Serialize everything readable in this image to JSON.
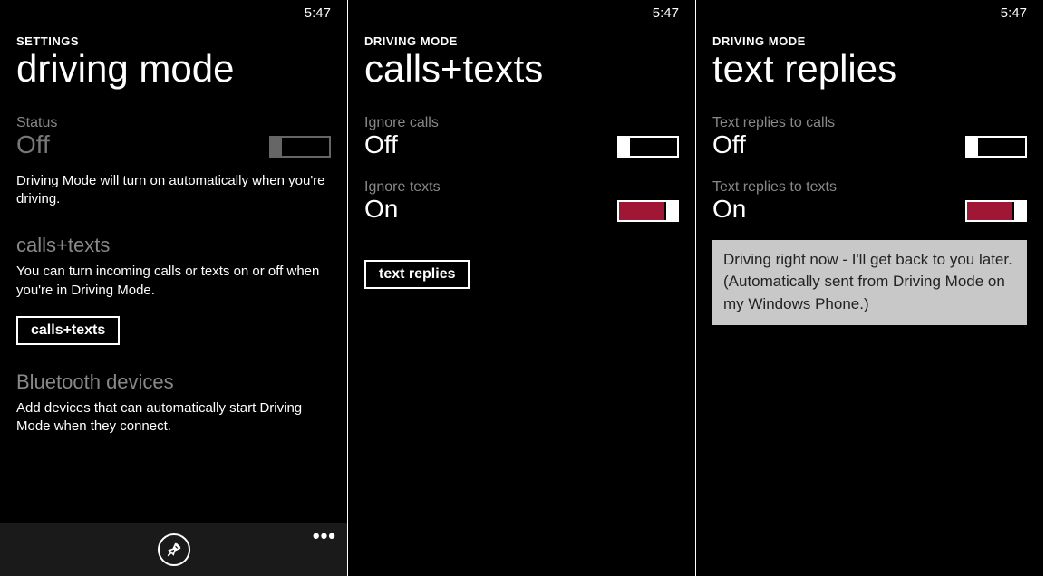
{
  "time": "5:47",
  "screen1": {
    "breadcrumb": "SETTINGS",
    "title": "driving mode",
    "status": {
      "label": "Status",
      "value": "Off",
      "description": "Driving Mode will turn on automatically when you're driving."
    },
    "callsTexts": {
      "title": "calls+texts",
      "description": "You can turn incoming calls or texts on or off when you're in Driving Mode.",
      "button": "calls+texts"
    },
    "bluetooth": {
      "title": "Bluetooth devices",
      "description": "Add devices that can automatically start Driving Mode when they connect."
    }
  },
  "screen2": {
    "breadcrumb": "DRIVING MODE",
    "title": "calls+texts",
    "ignoreCalls": {
      "label": "Ignore calls",
      "value": "Off"
    },
    "ignoreTexts": {
      "label": "Ignore texts",
      "value": "On"
    },
    "button": "text replies"
  },
  "screen3": {
    "breadcrumb": "DRIVING MODE",
    "title": "text replies",
    "repliesCalls": {
      "label": "Text replies to calls",
      "value": "Off"
    },
    "repliesTexts": {
      "label": "Text replies to texts",
      "value": "On"
    },
    "message": "Driving right now - I'll get back to you later. (Automatically sent from Driving Mode on my Windows Phone.)"
  }
}
